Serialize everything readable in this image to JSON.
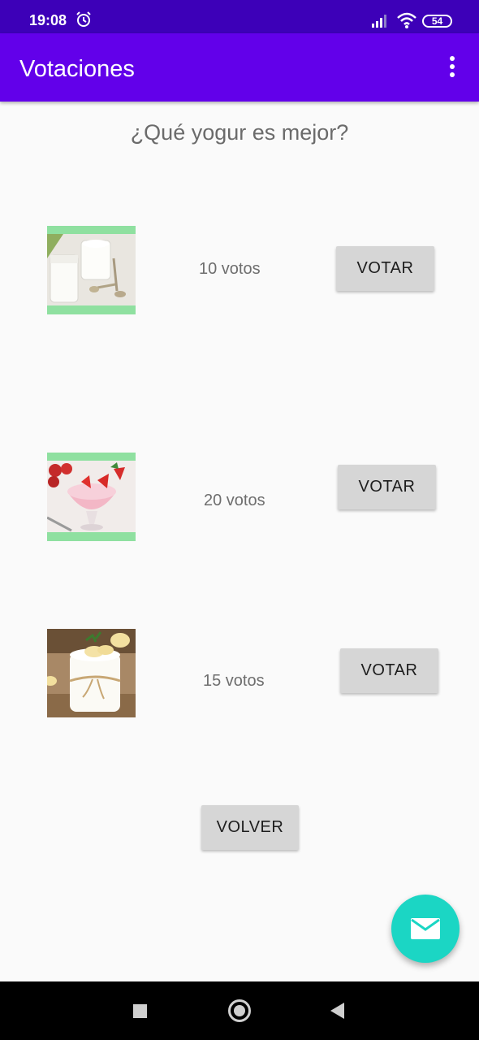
{
  "status_bar": {
    "time": "19:08",
    "battery": "54",
    "icons": [
      "alarm-icon",
      "signal-icon",
      "wifi-icon",
      "battery-icon"
    ]
  },
  "app_bar": {
    "title": "Votaciones",
    "menu_icon": "overflow-menu-icon"
  },
  "question": "¿Qué yogur es mejor?",
  "items": [
    {
      "image": "plain-yogurt-image",
      "votes": "10 votos",
      "button": "VOTAR"
    },
    {
      "image": "strawberry-yogurt-image",
      "votes": "20 votos",
      "button": "VOTAR"
    },
    {
      "image": "banana-yogurt-image",
      "votes": "15 votos",
      "button": "VOTAR"
    }
  ],
  "back_button": "VOLVER",
  "fab_icon": "email-icon",
  "nav_bar": {
    "icons": [
      "recent-apps-icon",
      "home-icon",
      "back-icon"
    ]
  },
  "colors": {
    "status_bar": "#3d00b8",
    "app_bar": "#6200ea",
    "fab": "#1bd6c4",
    "button": "#d6d6d6"
  }
}
